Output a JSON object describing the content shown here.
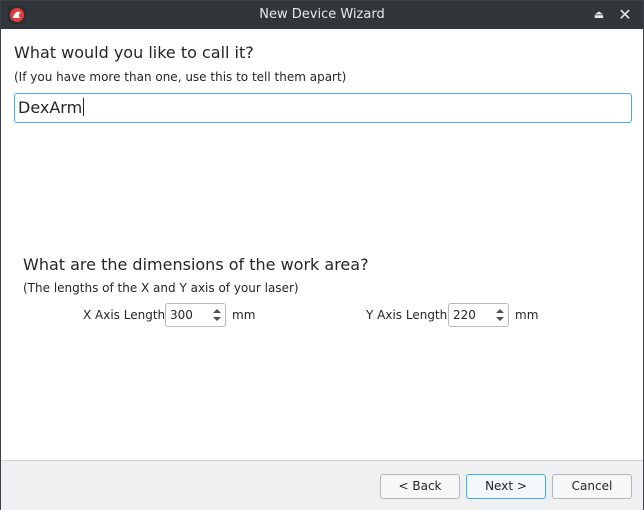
{
  "window": {
    "title": "New Device Wizard",
    "icons": {
      "app": "app-logo-icon",
      "keep_above": "keep-above-icon",
      "close": "close-icon"
    }
  },
  "name_section": {
    "heading": "What would you like to call it?",
    "subheading": "(If you have more than one, use this to tell them apart)",
    "name_value": "DexArm"
  },
  "dimensions_section": {
    "heading": "What are the dimensions of the work area?",
    "subheading": "(The lengths of the X and Y axis of your laser)",
    "x_axis": {
      "label": "X Axis Length",
      "value": "300",
      "unit": "mm"
    },
    "y_axis": {
      "label": "Y Axis Length",
      "value": "220",
      "unit": "mm"
    }
  },
  "buttons": {
    "back": "< Back",
    "next": "Next >",
    "cancel": "Cancel"
  },
  "colors": {
    "accent": "#3daee9",
    "titlebar": "#31363b",
    "footer": "#eff0f1"
  }
}
